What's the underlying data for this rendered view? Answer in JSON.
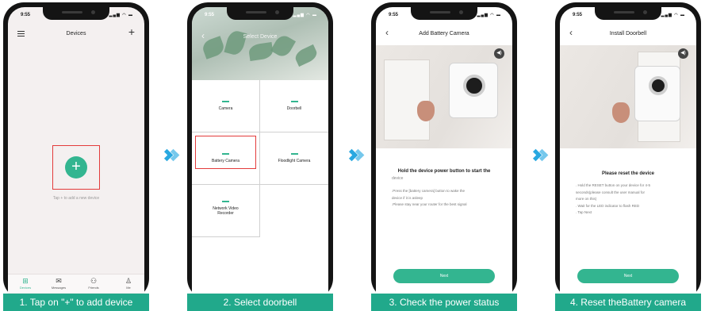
{
  "status_time": "9:55",
  "status_icons": "▂▄▆ ◠ ▬",
  "screen1": {
    "title": "Devices",
    "add_label": "+",
    "hint": "Tap + to add a new device",
    "tabs": [
      {
        "icon": "⊞",
        "label": "Devices"
      },
      {
        "icon": "✉",
        "label": "Messages"
      },
      {
        "icon": "⚇",
        "label": "Friends"
      },
      {
        "icon": "♙",
        "label": "Me"
      }
    ]
  },
  "screen2": {
    "title": "Select Device",
    "items": [
      "Camera",
      "Doorbell",
      "Battery Camera",
      "Floodlight Camera",
      "Network Video Recorder"
    ]
  },
  "screen3": {
    "title": "Add Battery  Camera",
    "heading": "Hold the device power button to start the",
    "subheading": "device",
    "lines": [
      ".Press the [battery camera] button to wake the",
      "device if it is asleep",
      ".Please stay near your router for the best signal"
    ],
    "next": "Next"
  },
  "screen4": {
    "title": "Install Doorbell",
    "heading": "Please reset the device",
    "lines": [
      ". Hold the RESET button on your device for 4-5",
      "seconds(please consult the user manual for",
      "more on this)",
      ". Wait for the LED indicator to flash RED",
      ". Tap Next"
    ],
    "next": "Next"
  },
  "captions": [
    "1. Tap on \"+\" to add device",
    "2. Select doorbell",
    "3. Check the power status",
    "4. Reset theBattery camera"
  ],
  "icons": {
    "back": "‹",
    "plus": "+",
    "speaker": "◀)"
  },
  "colors": {
    "accent": "#33b590",
    "caption_bg": "#21a98b",
    "highlight": "#e33b3b",
    "arrow": "#29a8e0"
  }
}
